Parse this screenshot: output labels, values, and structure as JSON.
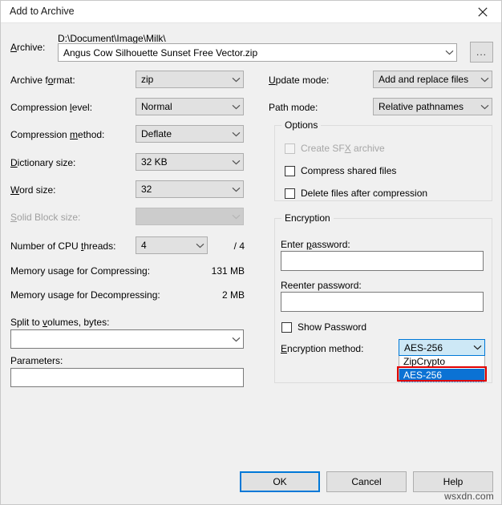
{
  "window": {
    "title": "Add to Archive",
    "close_icon": "close-icon"
  },
  "archive": {
    "label": "Archive:",
    "path": "D:\\Document\\Image\\Milk\\",
    "filename": "Angus Cow Silhouette Sunset Free Vector.zip",
    "browse_label": "..."
  },
  "left_fields": [
    {
      "label": "Archive format:",
      "value": "zip",
      "disabled": false
    },
    {
      "label": "Compression level:",
      "value": "Normal",
      "disabled": false
    },
    {
      "label": "Compression method:",
      "value": "Deflate",
      "disabled": false
    },
    {
      "label": "Dictionary size:",
      "value": "32 KB",
      "disabled": false
    },
    {
      "label": "Word size:",
      "value": "32",
      "disabled": false
    },
    {
      "label": "Solid Block size:",
      "value": "",
      "disabled": true
    }
  ],
  "threads": {
    "label": "Number of CPU threads:",
    "value": "4",
    "total": "/ 4"
  },
  "memory": {
    "compress_label": "Memory usage for Compressing:",
    "compress_value": "131 MB",
    "decompress_label": "Memory usage for Decompressing:",
    "decompress_value": "2 MB"
  },
  "split": {
    "label": "Split to volumes, bytes:",
    "value": ""
  },
  "parameters": {
    "label": "Parameters:",
    "value": ""
  },
  "update_mode": {
    "label": "Update mode:",
    "value": "Add and replace files"
  },
  "path_mode": {
    "label": "Path mode:",
    "value": "Relative pathnames"
  },
  "options": {
    "title": "Options",
    "items": [
      {
        "label": "Create SFX archive",
        "checked": false,
        "disabled": true
      },
      {
        "label": "Compress shared files",
        "checked": false,
        "disabled": false
      },
      {
        "label": "Delete files after compression",
        "checked": false,
        "disabled": false
      }
    ]
  },
  "encryption": {
    "title": "Encryption",
    "enter_password_label": "Enter password:",
    "enter_password_value": "",
    "reenter_password_label": "Reenter password:",
    "reenter_password_value": "",
    "show_password_label": "Show Password",
    "show_password_checked": false,
    "method_label": "Encryption method:",
    "method_value": "AES-256",
    "method_options": [
      "ZipCrypto",
      "AES-256"
    ],
    "method_selected_index": 1
  },
  "buttons": {
    "ok": "OK",
    "cancel": "Cancel",
    "help": "Help"
  },
  "watermark": "wsxdn.com",
  "colors": {
    "accent": "#0078d7",
    "selection": "#0b72d4",
    "annotation": "#e00000",
    "dialog_bg": "#f0f0f0"
  }
}
